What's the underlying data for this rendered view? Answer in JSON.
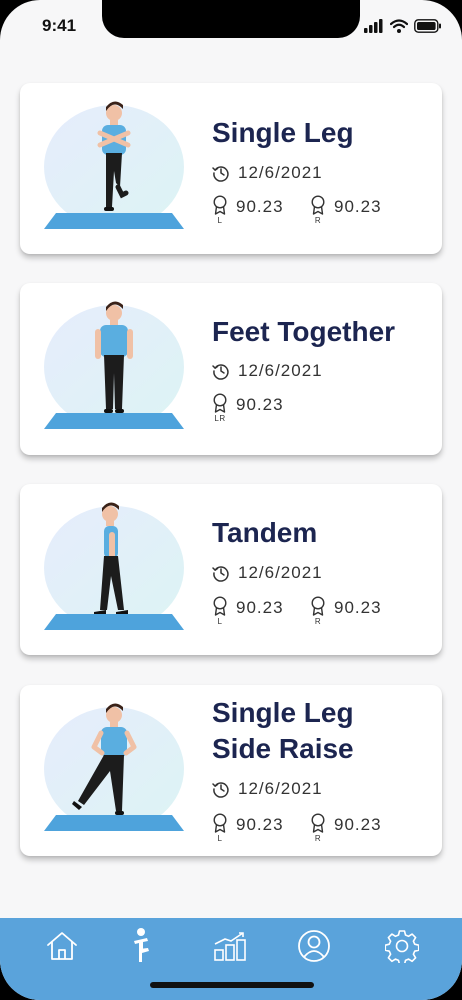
{
  "status": {
    "time": "9:41"
  },
  "cards": [
    {
      "title_lines": [
        "Single Leg"
      ],
      "date": "12/6/2021",
      "scores": [
        {
          "side": "L",
          "value": "90.23"
        },
        {
          "side": "R",
          "value": "90.23"
        }
      ]
    },
    {
      "title_lines": [
        "Feet Together"
      ],
      "date": "12/6/2021",
      "scores": [
        {
          "side": "LR",
          "value": "90.23"
        }
      ]
    },
    {
      "title_lines": [
        "Tandem"
      ],
      "date": "12/6/2021",
      "scores": [
        {
          "side": "L",
          "value": "90.23"
        },
        {
          "side": "R",
          "value": "90.23"
        }
      ]
    },
    {
      "title_lines": [
        "Single Leg",
        "Side Raise"
      ],
      "date": "12/6/2021",
      "scores": [
        {
          "side": "L",
          "value": "90.23"
        },
        {
          "side": "R",
          "value": "90.23"
        }
      ]
    }
  ],
  "tabs": [
    {
      "icon": "home-icon"
    },
    {
      "icon": "exercise-icon"
    },
    {
      "icon": "progress-chart-icon"
    },
    {
      "icon": "profile-icon"
    },
    {
      "icon": "settings-icon"
    }
  ],
  "colors": {
    "accent": "#5aa3db",
    "title": "#1c2550",
    "mat": "#4ea3dc",
    "shirt": "#5aaee0"
  }
}
